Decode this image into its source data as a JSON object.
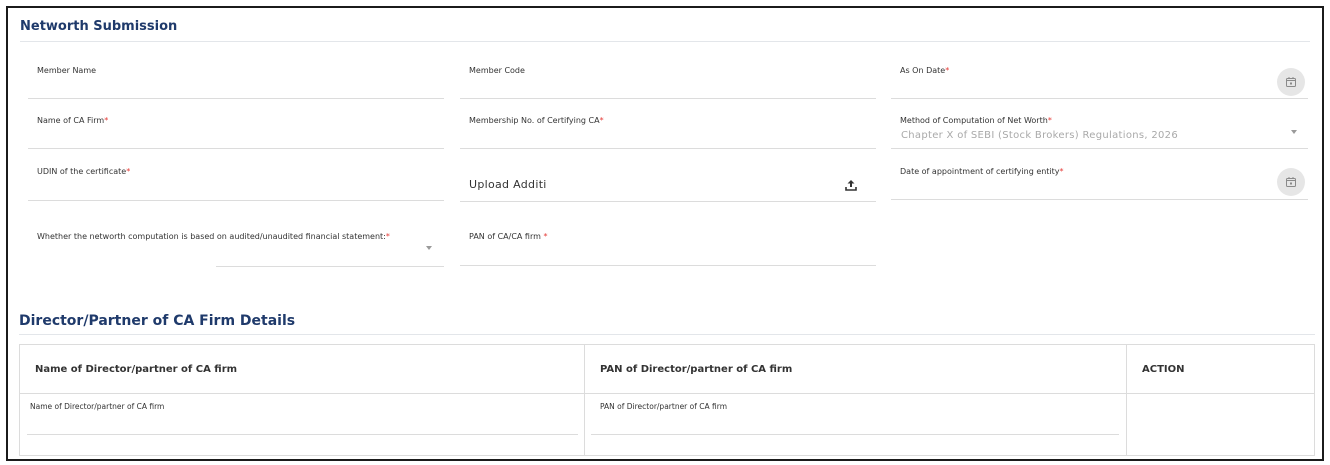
{
  "section1": {
    "title": "Networth Submission",
    "fields": {
      "member_name": {
        "label": "Member Name"
      },
      "member_code": {
        "label": "Member Code"
      },
      "as_on_date": {
        "label": "As On Date",
        "required": "*"
      },
      "ca_firm_name": {
        "label": "Name of CA Firm",
        "required": "*"
      },
      "membership_no": {
        "label": "Membership No. of Certifying CA",
        "required": "*"
      },
      "method": {
        "label": "Method of Computation of Net Worth",
        "required": "*",
        "value": "Chapter X of SEBI (Stock Brokers) Regulations, 2026"
      },
      "udin": {
        "label": "UDIN of the certificate",
        "required": "*"
      },
      "upload": {
        "label": "Upload Additi"
      },
      "appointment_date": {
        "label": "Date of appointment of certifying entity",
        "required": "*"
      },
      "audited": {
        "label": "Whether the networth computation is based on audited/unaudited financial statement:",
        "required": "*"
      },
      "pan_ca": {
        "label": "PAN of CA/CA firm ",
        "required": "*"
      }
    }
  },
  "section2": {
    "title": "Director/Partner of CA Firm Details",
    "columns": [
      "Name of Director/partner of CA firm",
      "PAN of Director/partner of CA firm",
      "ACTION"
    ],
    "row": {
      "name_label": "Name of Director/partner of CA firm",
      "pan_label": "PAN of Director/partner of CA firm"
    }
  },
  "icons": {
    "calendar": "calendar-icon",
    "upload": "upload-icon",
    "dropdown": "chevron-down-icon"
  },
  "colors": {
    "title": "#1f3a6b",
    "required": "#e53935"
  }
}
